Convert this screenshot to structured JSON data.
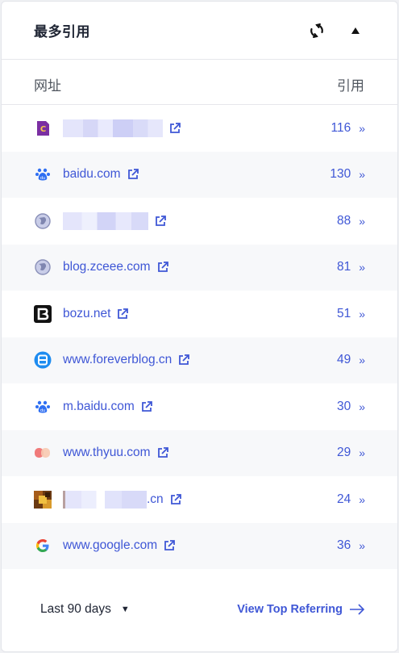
{
  "header": {
    "title": "最多引用",
    "refresh_icon": "refresh-icon",
    "collapse_icon": "triangle-up-icon"
  },
  "columns": {
    "site": "网址",
    "refs": "引用"
  },
  "rows": [
    {
      "site": "",
      "count": "116",
      "favicon": "purple-c-icon",
      "blurred": true
    },
    {
      "site": "baidu.com",
      "count": "130",
      "favicon": "baidu-paw-icon"
    },
    {
      "site": "",
      "count": "88",
      "favicon": "globe-icon",
      "blurred": true
    },
    {
      "site": "blog.zceee.com",
      "count": "81",
      "favicon": "globe-icon"
    },
    {
      "site": "bozu.net",
      "count": "51",
      "favicon": "bozu-b-icon"
    },
    {
      "site": "www.foreverblog.cn",
      "count": "49",
      "favicon": "foreverblog-icon"
    },
    {
      "site": "m.baidu.com",
      "count": "30",
      "favicon": "baidu-paw-icon"
    },
    {
      "site": "www.thyuu.com",
      "count": "29",
      "favicon": "thyuu-icon"
    },
    {
      "site": ".cn",
      "count": "24",
      "favicon": "image-avatar-icon",
      "blurred": true
    },
    {
      "site": "www.google.com",
      "count": "36",
      "favicon": "google-g-icon"
    }
  ],
  "footer": {
    "range_label": "Last 90 days",
    "view_label": "View Top Referring"
  },
  "colors": {
    "accent": "#3f57d6",
    "text": "#1e2433",
    "muted": "#50565f",
    "alt_row": "#f7f8fa"
  }
}
